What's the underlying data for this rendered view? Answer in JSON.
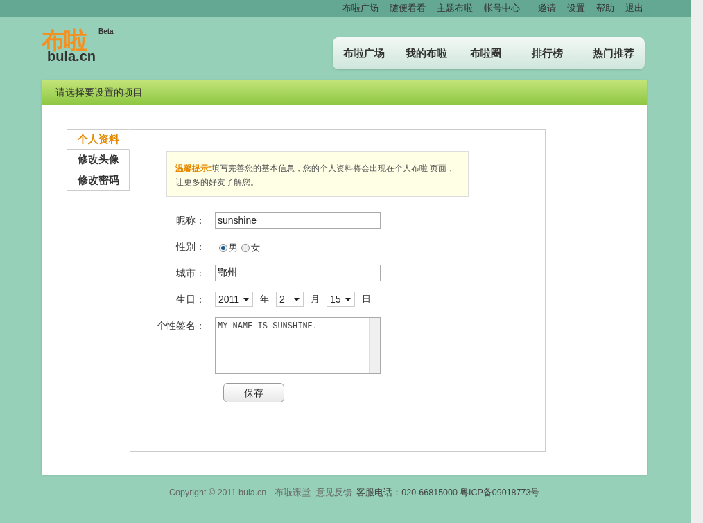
{
  "top_links": [
    "布啦广场",
    "随便看看",
    "主题布啦",
    "帐号中心",
    "邀请",
    "设置",
    "帮助",
    "退出"
  ],
  "logo": {
    "name": "布啦",
    "domain": "bula.cn",
    "badge": "Beta"
  },
  "nav": [
    "布啦广场",
    "我的布啦",
    "布啦圈",
    "排行榜",
    "热门推荐"
  ],
  "panel_title": "请选择要设置的项目",
  "tabs": [
    {
      "label": "个人资料",
      "selected": true
    },
    {
      "label": "修改头像",
      "selected": false
    },
    {
      "label": "修改密码",
      "selected": false
    }
  ],
  "tip": {
    "label": "温馨提示:",
    "text": "填写完善您的基本信息，您的个人资料将会出现在个人布啦 页面，让更多的好友了解您。"
  },
  "form": [
    {
      "kind": "text",
      "label": "昵称：",
      "value": "sunshine"
    },
    {
      "kind": "radio",
      "label": "性别：",
      "options": [
        {
          "label": "男",
          "selected": true
        },
        {
          "label": "女",
          "selected": false
        }
      ]
    },
    {
      "kind": "text",
      "label": "城市：",
      "value": "鄂州"
    },
    {
      "kind": "date",
      "label": "生日：",
      "parts": [
        {
          "value": "2011",
          "unit": "年"
        },
        {
          "value": "2",
          "unit": "月"
        },
        {
          "value": "15",
          "unit": "日"
        }
      ]
    },
    {
      "kind": "textarea",
      "label": "个性签名：",
      "value": "MY NAME IS SUNSHINE."
    }
  ],
  "save_button": "保存",
  "footer": {
    "copyright": "Copyright © 2011 bula.cn",
    "links": [
      "布啦课堂",
      "意见反馈"
    ],
    "contact": "客服电话：020-66815000",
    "icp": "粤ICP备09018773号"
  }
}
